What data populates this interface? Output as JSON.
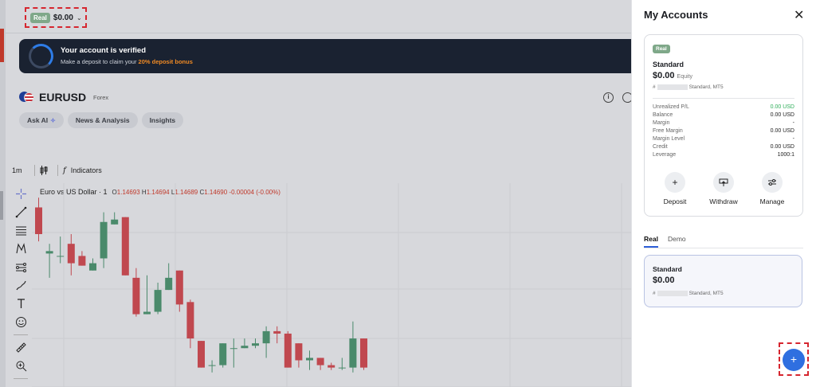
{
  "header": {
    "account_chip": "Real",
    "balance": "$0.00"
  },
  "banner": {
    "title": "Your account is verified",
    "subtitle_pre": "Make a deposit to claim your ",
    "subtitle_accent": "20% deposit bonus"
  },
  "instrument": {
    "symbol": "EURUSD",
    "class": "Forex",
    "tabs": [
      "Ask AI",
      "News & Analysis",
      "Insights"
    ]
  },
  "toolbar": {
    "interval": "1m",
    "indicators_label": "Indicators"
  },
  "legend": {
    "name": "Euro vs US Dollar · 1",
    "o_label": "O",
    "o_value": "1.14693",
    "h_label": "H",
    "h_value": "1.14694",
    "l_label": "L",
    "l_value": "1.14689",
    "c_label": "C",
    "c_value": "1.14690",
    "change": "-0.00004 (-0.00%)"
  },
  "chart_data": {
    "type": "candlestick",
    "up_color": "#4a8a6b",
    "down_color": "#c0484f",
    "candles": [
      {
        "o": 1.14722,
        "h": 1.14726,
        "l": 1.14708,
        "c": 1.14711
      },
      {
        "o": 1.14703,
        "h": 1.14707,
        "l": 1.14693,
        "c": 1.14704
      },
      {
        "o": 1.14702,
        "h": 1.1471,
        "l": 1.14699,
        "c": 1.14702
      },
      {
        "o": 1.14707,
        "h": 1.14711,
        "l": 1.14694,
        "c": 1.14699
      },
      {
        "o": 1.14702,
        "h": 1.14704,
        "l": 1.14698,
        "c": 1.14698
      },
      {
        "o": 1.14696,
        "h": 1.14701,
        "l": 1.14696,
        "c": 1.14699
      },
      {
        "o": 1.14701,
        "h": 1.1472,
        "l": 1.14697,
        "c": 1.14716
      },
      {
        "o": 1.14715,
        "h": 1.1472,
        "l": 1.14717,
        "c": 1.14717
      },
      {
        "o": 1.14718,
        "h": 1.14718,
        "l": 1.14694,
        "c": 1.14694
      },
      {
        "o": 1.14693,
        "h": 1.14697,
        "l": 1.14677,
        "c": 1.14678
      },
      {
        "o": 1.14678,
        "h": 1.14694,
        "l": 1.14678,
        "c": 1.14679
      },
      {
        "o": 1.14679,
        "h": 1.14691,
        "l": 1.14678,
        "c": 1.14688
      },
      {
        "o": 1.14688,
        "h": 1.14699,
        "l": 1.14688,
        "c": 1.14693
      },
      {
        "o": 1.14696,
        "h": 1.14696,
        "l": 1.14679,
        "c": 1.14682
      },
      {
        "o": 1.14683,
        "h": 1.14684,
        "l": 1.14664,
        "c": 1.14668
      },
      {
        "o": 1.14667,
        "h": 1.14667,
        "l": 1.14656,
        "c": 1.14656
      },
      {
        "o": 1.14657,
        "h": 1.14659,
        "l": 1.14654,
        "c": 1.14657
      },
      {
        "o": 1.14657,
        "h": 1.14666,
        "l": 1.14656,
        "c": 1.14666
      },
      {
        "o": 1.14664,
        "h": 1.14668,
        "l": 1.14656,
        "c": 1.14664
      },
      {
        "o": 1.14664,
        "h": 1.14668,
        "l": 1.14665,
        "c": 1.14665
      },
      {
        "o": 1.14665,
        "h": 1.14668,
        "l": 1.14664,
        "c": 1.14666
      },
      {
        "o": 1.14666,
        "h": 1.14673,
        "l": 1.1466,
        "c": 1.14671
      },
      {
        "o": 1.14671,
        "h": 1.14673,
        "l": 1.14666,
        "c": 1.1467
      },
      {
        "o": 1.1467,
        "h": 1.14671,
        "l": 1.14656,
        "c": 1.14656
      },
      {
        "o": 1.14666,
        "h": 1.14666,
        "l": 1.14656,
        "c": 1.14659
      },
      {
        "o": 1.14659,
        "h": 1.14663,
        "l": 1.14655,
        "c": 1.1466
      },
      {
        "o": 1.1466,
        "h": 1.14659,
        "l": 1.14655,
        "c": 1.14657
      },
      {
        "o": 1.14657,
        "h": 1.14658,
        "l": 1.14655,
        "c": 1.14656
      },
      {
        "o": 1.14656,
        "h": 1.1466,
        "l": 1.14655,
        "c": 1.14656
      },
      {
        "o": 1.14656,
        "h": 1.14675,
        "l": 1.14654,
        "c": 1.14668
      },
      {
        "o": 1.14668,
        "h": 1.14668,
        "l": 1.14655,
        "c": 1.14656
      }
    ]
  },
  "panel": {
    "title": "My Accounts",
    "card": {
      "chip": "Real",
      "type": "Standard",
      "equity": "$0.00",
      "equity_label": "Equity",
      "acct_prefix": "#",
      "acct_suffix": "Standard, MT5",
      "stats": [
        {
          "k": "Unrealized P/L",
          "v": "0.00 USD",
          "green": true
        },
        {
          "k": "Balance",
          "v": "0.00 USD"
        },
        {
          "k": "Margin",
          "v": "-"
        },
        {
          "k": "Free Margin",
          "v": "0.00 USD"
        },
        {
          "k": "Margin Level",
          "v": "-"
        },
        {
          "k": "Credit",
          "v": "0.00 USD"
        },
        {
          "k": "Leverage",
          "v": "1000:1"
        }
      ],
      "actions": {
        "deposit": "Deposit",
        "withdraw": "Withdraw",
        "manage": "Manage"
      }
    },
    "tabs": {
      "real": "Real",
      "demo": "Demo"
    },
    "account_row": {
      "type": "Standard",
      "value": "$0.00",
      "acct_prefix": "#",
      "acct_suffix": "Standard, MT5"
    },
    "add_label": "+"
  }
}
